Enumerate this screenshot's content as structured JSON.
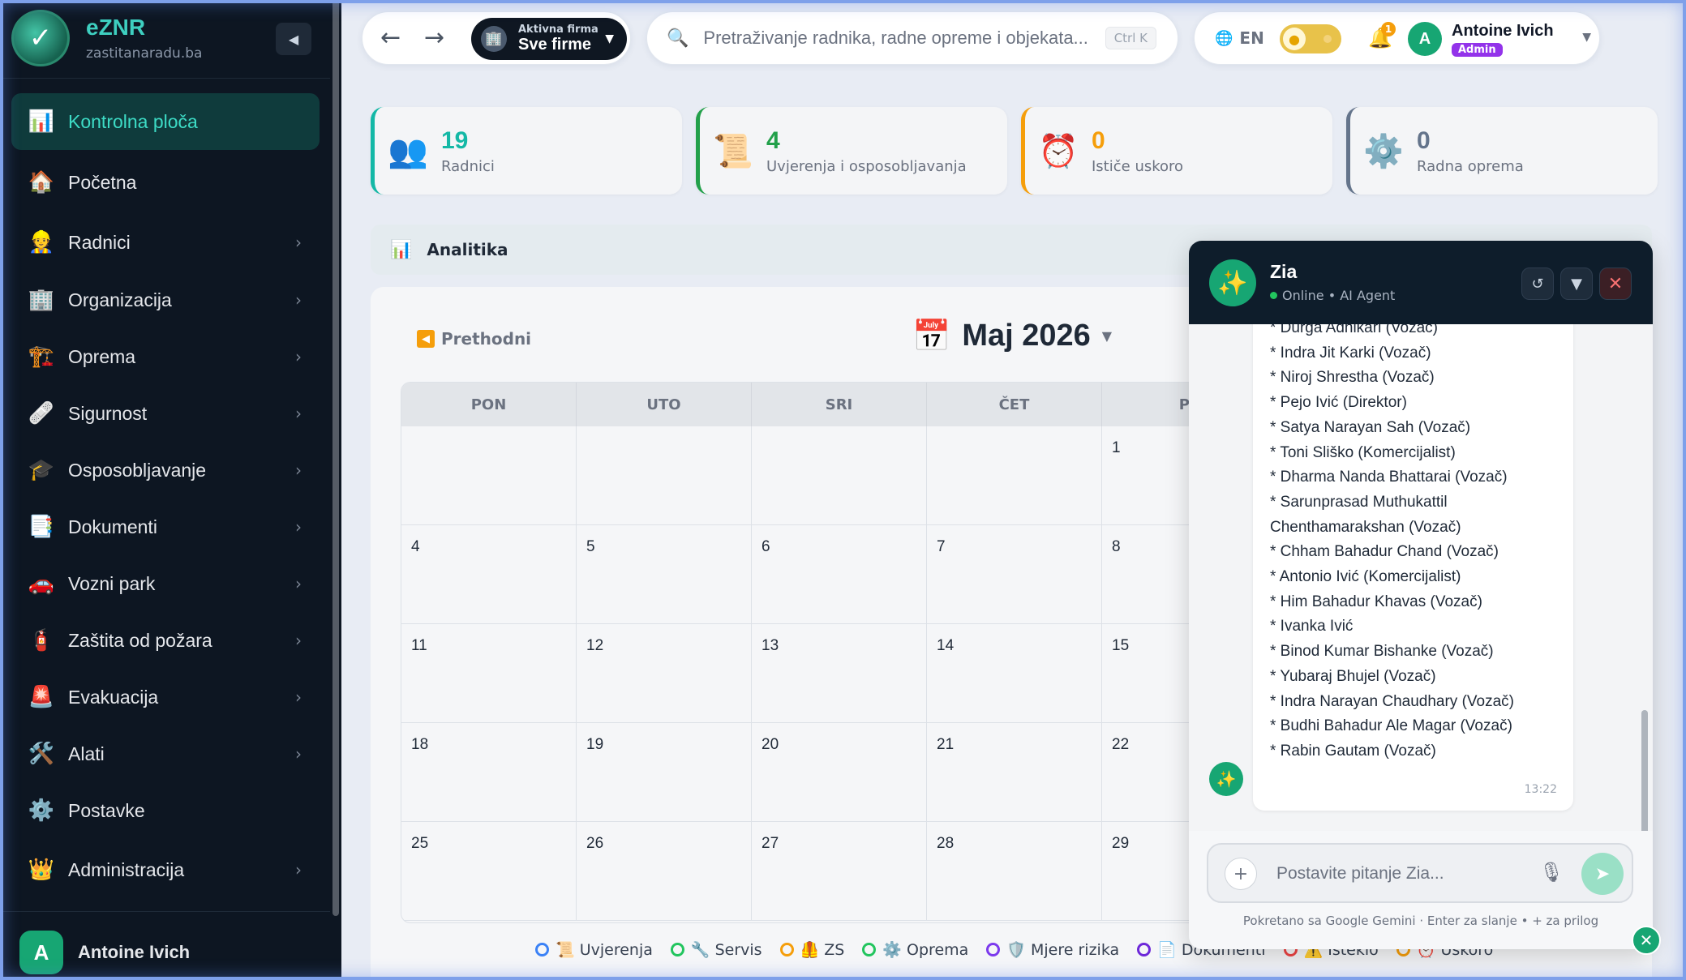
{
  "brand": {
    "name": "eZNR",
    "sub": "zastitanaradu.ba"
  },
  "sidebar": {
    "items": [
      {
        "label": "Kontrolna ploča",
        "icon": "📊",
        "icon_name": "chart-icon",
        "chevron": false,
        "active": true
      },
      {
        "label": "Početna",
        "icon": "🏠",
        "icon_name": "home-icon",
        "chevron": false
      },
      {
        "label": "Radnici",
        "icon": "👷",
        "icon_name": "worker-icon",
        "chevron": true
      },
      {
        "label": "Organizacija",
        "icon": "🏢",
        "icon_name": "building-icon",
        "chevron": true
      },
      {
        "label": "Oprema",
        "icon": "🏗️",
        "icon_name": "crane-icon",
        "chevron": true
      },
      {
        "label": "Sigurnost",
        "icon": "🩹",
        "icon_name": "bandage-icon",
        "chevron": true
      },
      {
        "label": "Osposobljavanje",
        "icon": "🎓",
        "icon_name": "graduation-cap-icon",
        "chevron": true
      },
      {
        "label": "Dokumenti",
        "icon": "📑",
        "icon_name": "document-icon",
        "chevron": true
      },
      {
        "label": "Vozni park",
        "icon": "🚗",
        "icon_name": "car-icon",
        "chevron": true
      },
      {
        "label": "Zaštita od požara",
        "icon": "🧯",
        "icon_name": "fire-extinguisher-icon",
        "chevron": true
      },
      {
        "label": "Evakuacija",
        "icon": "🚨",
        "icon_name": "siren-icon",
        "chevron": true
      },
      {
        "label": "Alati",
        "icon": "🛠️",
        "icon_name": "tools-icon",
        "chevron": true
      },
      {
        "label": "Postavke",
        "icon": "⚙️",
        "icon_name": "gear-icon",
        "chevron": false
      },
      {
        "label": "Administracija",
        "icon": "👑",
        "icon_name": "crown-icon",
        "chevron": true
      }
    ],
    "user": {
      "initial": "A",
      "name": "Antoine Ivich"
    }
  },
  "topbar": {
    "company_top": "Aktivna firma",
    "company_name": "Sve firme",
    "search_placeholder": "Pretraživanje radnika, radne opreme i objekata...",
    "search_shortcut": "Ctrl K",
    "lang": "EN",
    "notifications": "1",
    "user": {
      "initial": "A",
      "name": "Antoine Ivich",
      "role": "Admin"
    }
  },
  "stats": [
    {
      "value": "19",
      "label": "Radnici",
      "icon": "👥",
      "color": "#14b8a6"
    },
    {
      "value": "4",
      "label": "Uvjerenja i osposobljavanja",
      "icon": "📜",
      "color": "#22a04a"
    },
    {
      "value": "0",
      "label": "Ističe uskoro",
      "icon": "⏰",
      "color": "#f59e0b"
    },
    {
      "value": "0",
      "label": "Radna oprema",
      "icon": "⚙️",
      "color": "#64748b"
    }
  ],
  "analytics": {
    "title": "Analitika"
  },
  "calendar": {
    "prev_label": "Prethodni",
    "month": "Maj 2026",
    "headers": [
      "PON",
      "UTO",
      "SRI",
      "ČET",
      "PE"
    ],
    "weeks": [
      [
        "",
        "",
        "",
        "",
        "1"
      ],
      [
        "4",
        "5",
        "6",
        "7",
        "8"
      ],
      [
        "11",
        "12",
        "13",
        "14",
        "15"
      ],
      [
        "18",
        "19",
        "20",
        "21",
        "22"
      ],
      [
        "25",
        "26",
        "27",
        "28",
        "29"
      ]
    ]
  },
  "legend": [
    {
      "label": "📜 Uvjerenja",
      "color": "#3b82f6"
    },
    {
      "label": "🔧 Servis",
      "color": "#22c55e"
    },
    {
      "label": "🦺 ZS",
      "color": "#f59e0b"
    },
    {
      "label": "⚙️ Oprema",
      "color": "#22c55e"
    },
    {
      "label": "🛡️ Mjere rizika",
      "color": "#7c3aed"
    },
    {
      "label": "📄 Dokumenti",
      "color": "#6d28d9"
    },
    {
      "label": "⚠️ Isteklo",
      "color": "#ef4444"
    },
    {
      "label": "⏰ Uskoro",
      "color": "#f59e0b"
    }
  ],
  "chat": {
    "name": "Zia",
    "status": "Online • AI Agent",
    "lines": [
      "* Durga Adhikari (Vozač)",
      "* Indra Jit Karki (Vozač)",
      "* Niroj Shrestha (Vozač)",
      "* Pejo Ivić (Direktor)",
      "* Satya Narayan Sah (Vozač)",
      "* Toni Sliško (Komercijalist)",
      "* Dharma Nanda Bhattarai (Vozač)",
      "* Sarunprasad Muthukattil",
      "Chenthamarakshan (Vozač)",
      "* Chham Bahadur Chand (Vozač)",
      "* Antonio Ivić (Komercijalist)",
      "* Him Bahadur Khavas (Vozač)",
      "* Ivanka Ivić",
      "* Binod Kumar Bishanke (Vozač)",
      "* Yubaraj Bhujel (Vozač)",
      "* Indra Narayan Chaudhary (Vozač)",
      "* Budhi Bahadur Ale Magar (Vozač)",
      "* Rabin Gautam (Vozač)"
    ],
    "time": "13:22",
    "input_placeholder": "Postavite pitanje Zia...",
    "footer": "Pokretano sa Google Gemini · Enter za slanje • + za prilog"
  }
}
